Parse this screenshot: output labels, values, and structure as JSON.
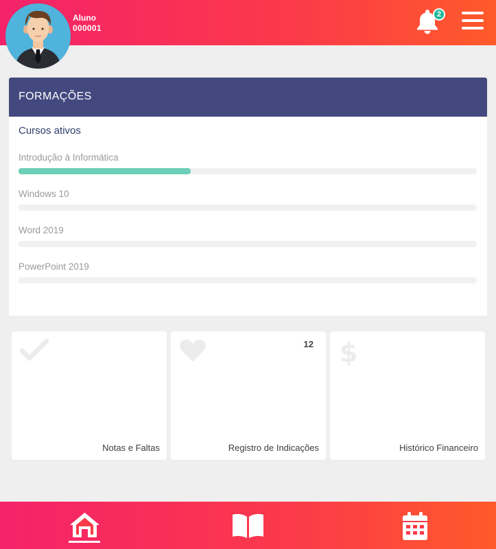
{
  "header": {
    "user_role": "Aluno",
    "user_id": "000001",
    "notification_count": "2",
    "icons": [
      "avatar",
      "bell-icon",
      "menu-icon"
    ]
  },
  "formacoes": {
    "title": "FORMAÇÕES",
    "subtitle": "Cursos ativos",
    "courses": [
      {
        "name": "Introdução à Informática",
        "progress": 0.375
      },
      {
        "name": "Windows 10",
        "progress": 0
      },
      {
        "name": "Word 2019",
        "progress": 0
      },
      {
        "name": "PowerPoint 2019",
        "progress": 0
      }
    ]
  },
  "tiles": [
    {
      "label": "Notas e Faltas",
      "icon": "check-icon"
    },
    {
      "label": "Registro de Indicações",
      "icon": "heart-icon",
      "count": "12"
    },
    {
      "label": "Histórico Financeiro",
      "icon": "dollar-icon"
    }
  ],
  "bottom_nav": [
    {
      "icon": "home-icon",
      "active": true
    },
    {
      "icon": "book-icon",
      "active": false
    },
    {
      "icon": "calendar-icon",
      "active": false
    }
  ],
  "colors": {
    "gradient_start": "#f5226a",
    "gradient_end": "#ff5a2a",
    "card_header": "#43497f",
    "progress_fill": "#6dcfb8",
    "badge": "#1fb79a"
  }
}
